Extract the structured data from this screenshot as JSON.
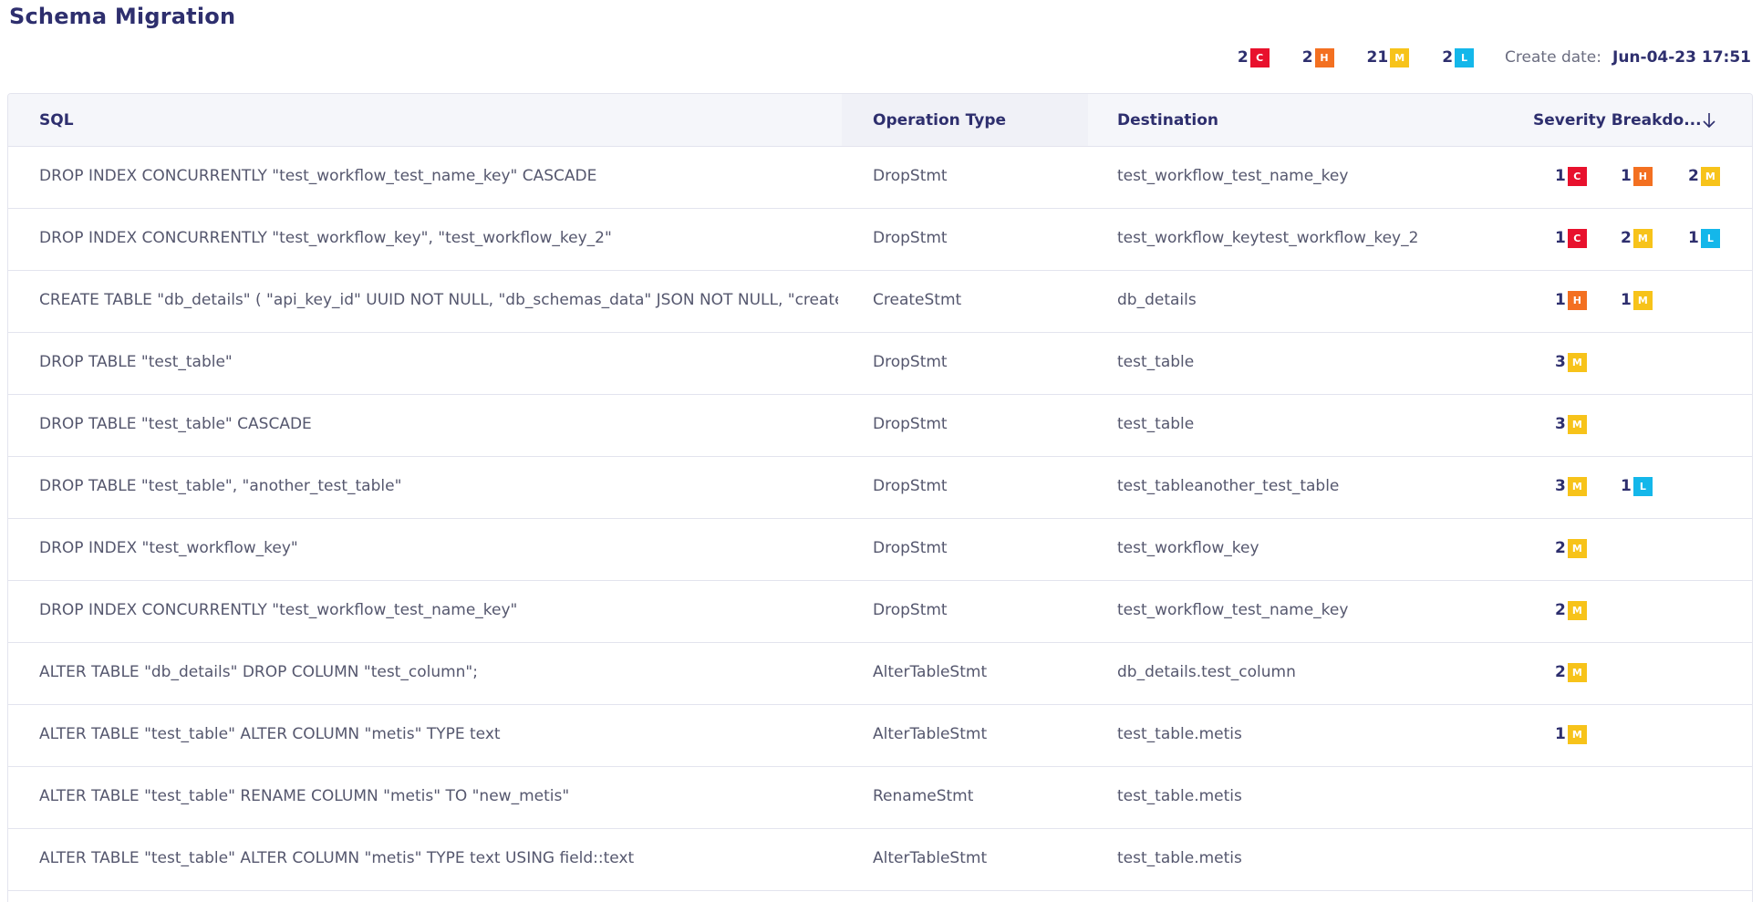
{
  "page": {
    "title": "Schema Migration"
  },
  "colors": {
    "C": "#e8112d",
    "H": "#f37021",
    "M": "#f7c31a",
    "L": "#14b7ea"
  },
  "summary": {
    "items": [
      {
        "count": "2",
        "level": "C"
      },
      {
        "count": "2",
        "level": "H"
      },
      {
        "count": "21",
        "level": "M"
      },
      {
        "count": "2",
        "level": "L"
      }
    ],
    "create_label": "Create date:",
    "create_value": "Jun-04-23 17:51"
  },
  "table": {
    "columns": {
      "sql": "SQL",
      "op": "Operation Type",
      "dest": "Destination",
      "sev": "Severity Breakdo..."
    },
    "sort_icon": "arrow-down-icon",
    "rows": [
      {
        "sql": "DROP INDEX CONCURRENTLY \"test_workflow_test_name_key\" CASCADE",
        "op": "DropStmt",
        "dest": "test_workflow_test_name_key",
        "sev": [
          {
            "count": "1",
            "level": "C"
          },
          {
            "count": "1",
            "level": "H"
          },
          {
            "count": "2",
            "level": "M"
          }
        ]
      },
      {
        "sql": "DROP INDEX CONCURRENTLY \"test_workflow_key\", \"test_workflow_key_2\"",
        "op": "DropStmt",
        "dest": "test_workflow_keytest_workflow_key_2",
        "sev": [
          {
            "count": "1",
            "level": "C"
          },
          {
            "count": "2",
            "level": "M"
          },
          {
            "count": "1",
            "level": "L"
          }
        ]
      },
      {
        "sql": "CREATE TABLE \"db_details\" ( \"api_key_id\" UUID NOT NULL, \"db_schemas_data\" JSON NOT NULL, \"created_at\" TIMESTAMP",
        "op": "CreateStmt",
        "dest": "db_details",
        "sev": [
          {
            "count": "1",
            "level": "H"
          },
          {
            "count": "1",
            "level": "M"
          }
        ]
      },
      {
        "sql": "DROP TABLE \"test_table\"",
        "op": "DropStmt",
        "dest": "test_table",
        "sev": [
          {
            "count": "3",
            "level": "M"
          }
        ]
      },
      {
        "sql": "DROP TABLE \"test_table\" CASCADE",
        "op": "DropStmt",
        "dest": "test_table",
        "sev": [
          {
            "count": "3",
            "level": "M"
          }
        ]
      },
      {
        "sql": "DROP TABLE \"test_table\", \"another_test_table\"",
        "op": "DropStmt",
        "dest": "test_tableanother_test_table",
        "sev": [
          {
            "count": "3",
            "level": "M"
          },
          {
            "count": "1",
            "level": "L"
          }
        ]
      },
      {
        "sql": "DROP INDEX \"test_workflow_key\"",
        "op": "DropStmt",
        "dest": "test_workflow_key",
        "sev": [
          {
            "count": "2",
            "level": "M"
          }
        ]
      },
      {
        "sql": "DROP INDEX CONCURRENTLY \"test_workflow_test_name_key\"",
        "op": "DropStmt",
        "dest": "test_workflow_test_name_key",
        "sev": [
          {
            "count": "2",
            "level": "M"
          }
        ]
      },
      {
        "sql": "ALTER TABLE \"db_details\" DROP COLUMN \"test_column\";",
        "op": "AlterTableStmt",
        "dest": "db_details.test_column",
        "sev": [
          {
            "count": "2",
            "level": "M"
          }
        ]
      },
      {
        "sql": "ALTER TABLE \"test_table\" ALTER COLUMN \"metis\" TYPE text",
        "op": "AlterTableStmt",
        "dest": "test_table.metis",
        "sev": [
          {
            "count": "1",
            "level": "M"
          }
        ]
      },
      {
        "sql": "ALTER TABLE \"test_table\" RENAME COLUMN \"metis\" TO \"new_metis\"",
        "op": "RenameStmt",
        "dest": "test_table.metis",
        "sev": []
      },
      {
        "sql": "ALTER TABLE \"test_table\" ALTER COLUMN \"metis\" TYPE text USING field::text",
        "op": "AlterTableStmt",
        "dest": "test_table.metis",
        "sev": []
      }
    ]
  }
}
